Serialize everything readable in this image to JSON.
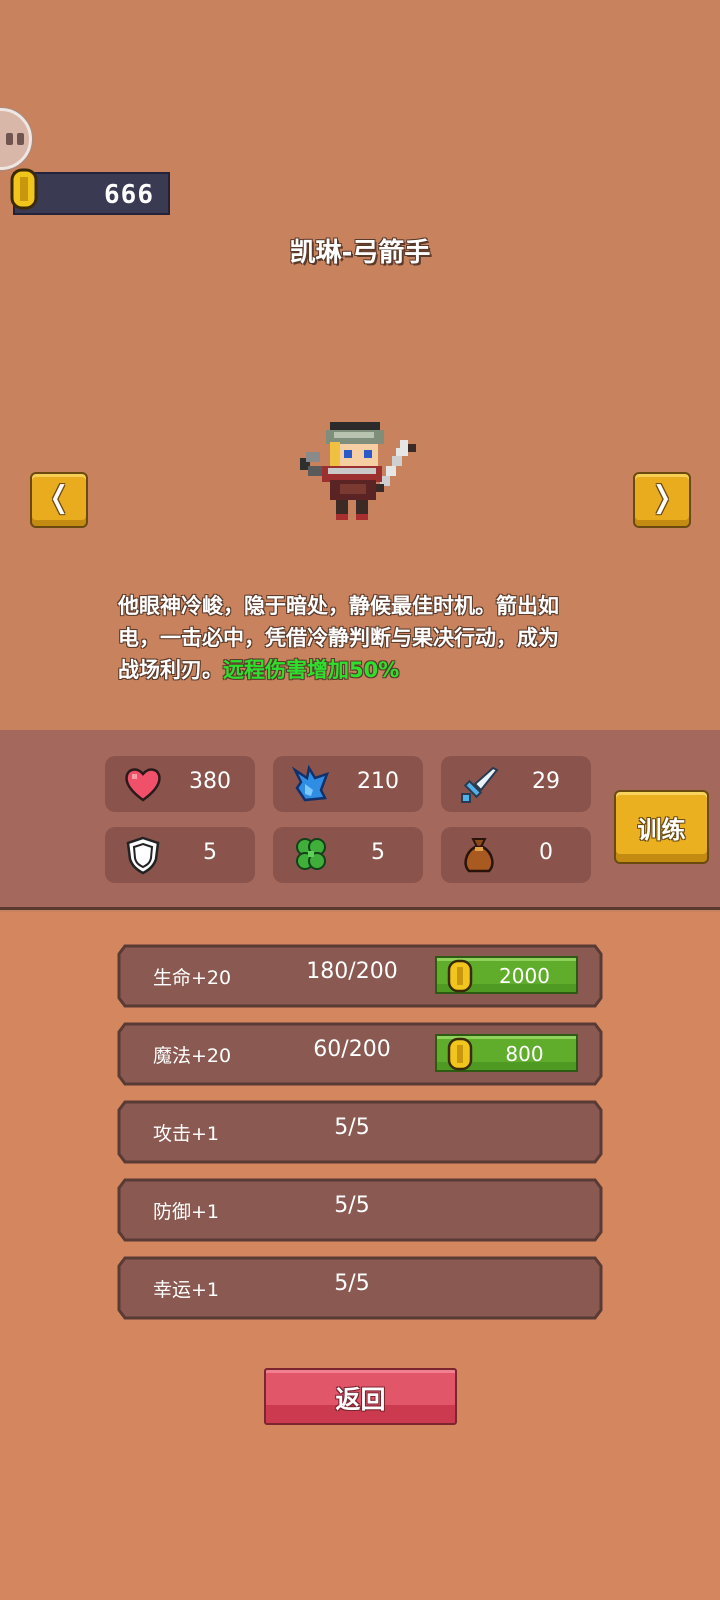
{
  "gold": "666",
  "hero": {
    "title": "凯琳-弓箭手",
    "desc_line1": "他眼神冷峻，隐于暗处，静候最佳时机。箭出如",
    "desc_line2": "电，一击必中，凭借冷静判断与果决行动，成为",
    "desc_line3_plain": "战场利刃。",
    "desc_line3_highlight": "远程伤害增加50%"
  },
  "nav": {
    "prev_symbol": "❬",
    "next_symbol": "❭"
  },
  "stats": [
    {
      "icon": "heart-icon",
      "value": "380"
    },
    {
      "icon": "mana-flame-icon",
      "value": "210"
    },
    {
      "icon": "sword-icon",
      "value": "29"
    },
    {
      "icon": "shield-icon",
      "value": "5"
    },
    {
      "icon": "clover-icon",
      "value": "5"
    },
    {
      "icon": "money-bag-icon",
      "value": "0"
    }
  ],
  "train_label": "训练",
  "upgrades": [
    {
      "name": "生命+20",
      "progress": "180/200",
      "price": "2000"
    },
    {
      "name": "魔法+20",
      "progress": "60/200",
      "price": "800"
    },
    {
      "name": "攻击+1",
      "progress": "5/5"
    },
    {
      "name": "防御+1",
      "progress": "5/5"
    },
    {
      "name": "幸运+1",
      "progress": "5/5"
    }
  ],
  "back_label": "返回",
  "colors": {
    "background": "#c8825e",
    "stats_panel": "#a5685c",
    "highlight_text": "#2ee02e",
    "gold_button": "#e9ac1f",
    "buy_button": "#5fad2b",
    "back_button": "#e2566a"
  }
}
